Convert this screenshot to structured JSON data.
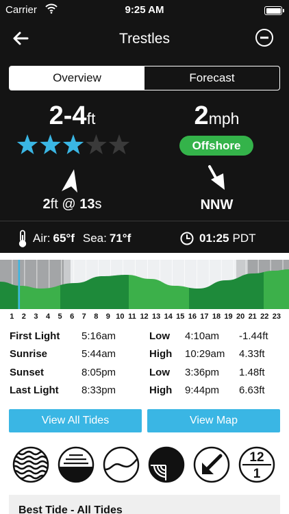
{
  "status_bar": {
    "carrier": "Carrier",
    "time": "9:25 AM"
  },
  "nav": {
    "title": "Trestles",
    "back_icon": "arrow-left-icon",
    "action_icon": "minus-circle-icon"
  },
  "tabs": [
    {
      "label": "Overview",
      "active": true
    },
    {
      "label": "Forecast",
      "active": false
    }
  ],
  "surf": {
    "height": "2-4",
    "height_unit": "ft",
    "rating": 3,
    "rating_max": 5,
    "swell_height": "2",
    "swell_unit": "ft",
    "swell_at": " @ ",
    "swell_period": "13",
    "period_unit": "s"
  },
  "wind": {
    "speed": "2",
    "unit": "mph",
    "condition": "Offshore",
    "direction": "NNW"
  },
  "temps": {
    "air_label": "Air:",
    "air": "65°f",
    "sea_label": "Sea:",
    "sea": "71°f",
    "local_time": "01:25",
    "tz": "PDT"
  },
  "tide_chart": {
    "hours": [
      "1",
      "2",
      "3",
      "4",
      "5",
      "6",
      "7",
      "8",
      "9",
      "10",
      "11",
      "12",
      "13",
      "14",
      "15",
      "16",
      "17",
      "18",
      "19",
      "20",
      "21",
      "22",
      "23"
    ],
    "current_hour": 2
  },
  "sun": [
    {
      "label": "First Light",
      "time": "5:16am"
    },
    {
      "label": "Sunrise",
      "time": "5:44am"
    },
    {
      "label": "Sunset",
      "time": "8:05pm"
    },
    {
      "label": "Last Light",
      "time": "8:33pm"
    }
  ],
  "tides": [
    {
      "type": "Low",
      "time": "4:10am",
      "height": "-1.44ft"
    },
    {
      "type": "High",
      "time": "10:29am",
      "height": "4.33ft"
    },
    {
      "type": "Low",
      "time": "3:36pm",
      "height": "1.48ft"
    },
    {
      "type": "High",
      "time": "9:44pm",
      "height": "6.63ft"
    }
  ],
  "buttons": {
    "tides": "View All Tides",
    "map": "View Map"
  },
  "tool_icons": [
    "swell-waves-icon",
    "sunrise-icon",
    "wave-curve-icon",
    "tide-quarter-icon",
    "direction-arrow-icon",
    "calendar-time-icon"
  ],
  "clock_badge": {
    "top": "12",
    "bottom": "1"
  },
  "bottom_panel": {
    "title": "Best Tide - All Tides"
  },
  "colors": {
    "accent": "#3ab6e4",
    "offshore": "#34b34a",
    "star": "#3ab6e4",
    "tide_light": "#3cb04a",
    "tide_dark": "#1e8a3a"
  }
}
